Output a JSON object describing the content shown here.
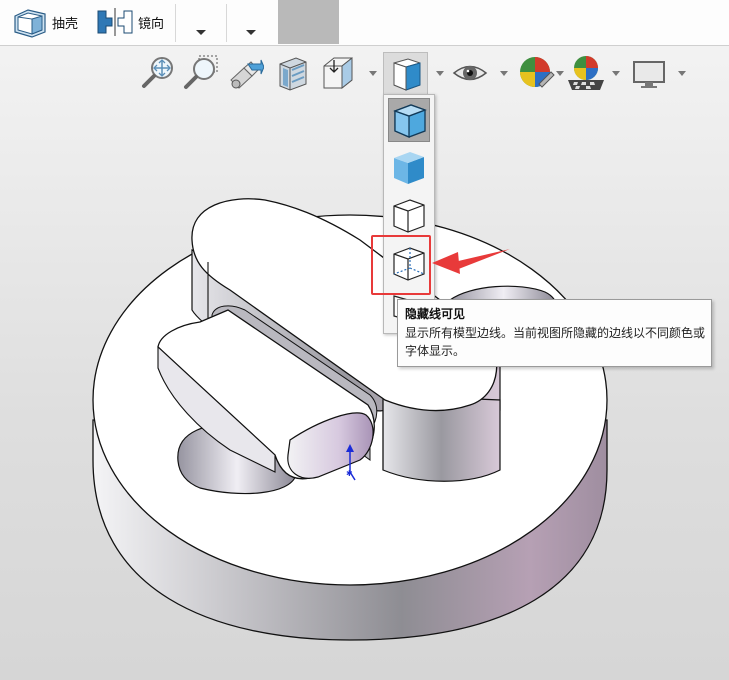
{
  "commandbar": {
    "shell_label": "抽壳",
    "mirror_label": "镜向"
  },
  "flyout": {
    "items": [
      "shaded-with-edges",
      "shaded",
      "wireframe",
      "hidden-lines-visible",
      "hidden-lines-removed"
    ]
  },
  "tooltip": {
    "title": "隐藏线可见",
    "description": "显示所有模型边线。当前视图所隐藏的边线以不同颜色或字体显示。"
  },
  "colors": {
    "highlight": "#e83a3a",
    "accent_blue": "#3a8fc8"
  }
}
